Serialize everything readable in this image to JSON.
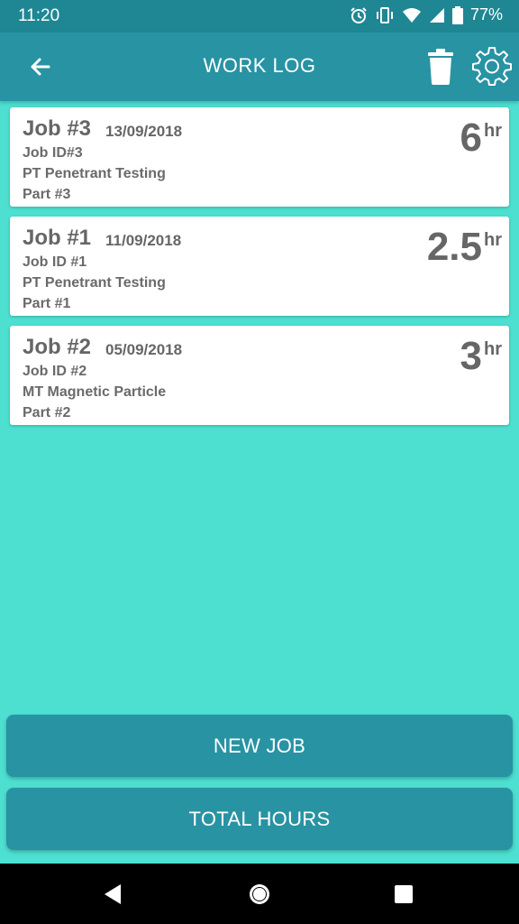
{
  "status_bar": {
    "time": "11:20",
    "battery_pct": "77%",
    "icons": [
      "alarm-icon",
      "vibrate-icon",
      "wifi-icon",
      "signal-icon",
      "battery-icon"
    ]
  },
  "app_bar": {
    "title": "WORK LOG",
    "icons": [
      "back-arrow-icon",
      "trash-icon",
      "gear-icon"
    ]
  },
  "jobs": [
    {
      "title": "Job #3",
      "date": "13/09/2018",
      "job_id": "Job ID#3",
      "method": "PT Penetrant Testing",
      "part": "Part #3",
      "hours": "6",
      "unit": "hr"
    },
    {
      "title": "Job #1",
      "date": "11/09/2018",
      "job_id": "Job ID #1",
      "method": "PT Penetrant Testing",
      "part": "Part #1",
      "hours": "2.5",
      "unit": "hr"
    },
    {
      "title": "Job #2",
      "date": "05/09/2018",
      "job_id": "Job ID #2",
      "method": "MT Magnetic Particle",
      "part": "Part #2",
      "hours": "3",
      "unit": "hr"
    }
  ],
  "buttons": {
    "new_job": "NEW JOB",
    "total_hours": "TOTAL HOURS"
  },
  "colors": {
    "background": "#4de0d1",
    "app_bar": "#2893a3",
    "status_bar": "#1f8794",
    "card": "#ffffff",
    "text": "#666666"
  }
}
